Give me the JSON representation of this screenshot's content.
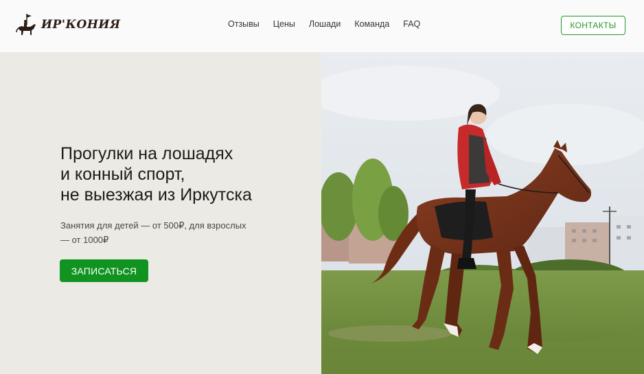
{
  "header": {
    "logo_text": "ИР'КОНИЯ",
    "nav": [
      "Отзывы",
      "Цены",
      "Лошади",
      "Команда",
      "FAQ"
    ],
    "contact_label": "КОНТАКТЫ"
  },
  "hero": {
    "title_lines": [
      "Прогулки на лошадях",
      "и конный спорт,",
      "не выезжая из Иркутска"
    ],
    "subtitle_lines": [
      "Занятия для детей — от 500₽, для взрослых",
      "— от 1000₽"
    ],
    "cta_label": "ЗАПИСАТЬСЯ"
  },
  "colors": {
    "accent_green": "#109320",
    "panel_bg": "#eceae5",
    "header_bg": "#fafafa"
  }
}
